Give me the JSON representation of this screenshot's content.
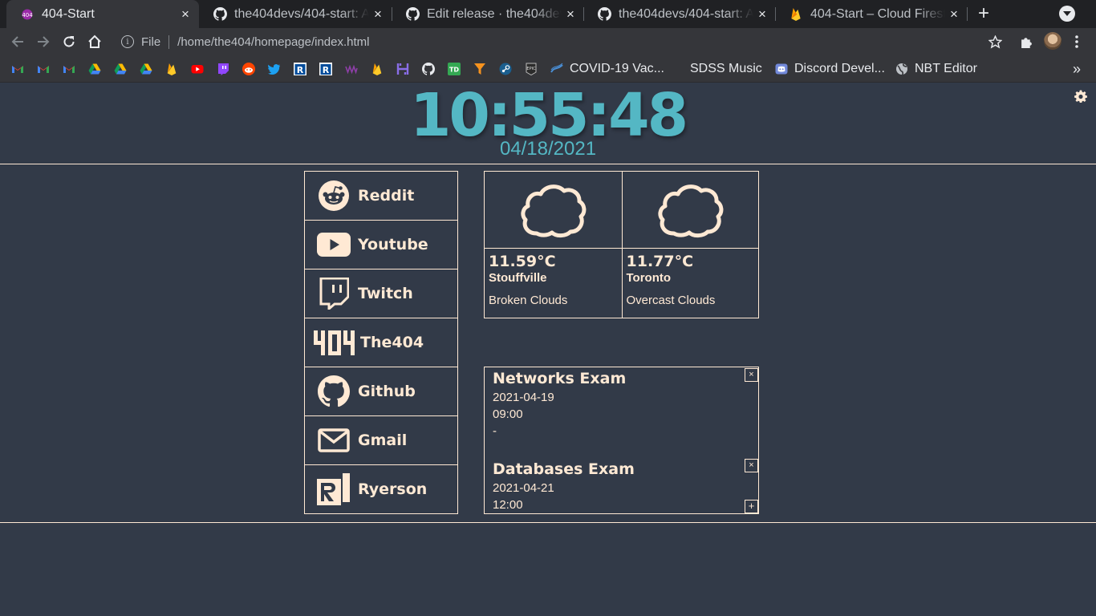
{
  "browser": {
    "tabs": [
      {
        "title": "404-Start",
        "icon": "404-start-favicon",
        "active": true
      },
      {
        "title": "the404devs/404-start: A simple startpage",
        "icon": "github-icon"
      },
      {
        "title": "Edit release · the404devs/404-start",
        "icon": "github-icon"
      },
      {
        "title": "the404devs/404-start: A simple startpage",
        "icon": "github-icon"
      },
      {
        "title": "404-Start – Cloud Firestore",
        "icon": "firebase-icon"
      }
    ],
    "close_glyph": "×",
    "new_tab_glyph": "+",
    "address": {
      "scheme_label": "File",
      "url": "/home/the404/homepage/index.html"
    },
    "bookmarks_named": [
      {
        "label": "COVID-19 Vac...",
        "icon": "covid-icon"
      },
      {
        "label": "SDSS Music",
        "icon": "blank-icon"
      },
      {
        "label": "Discord Devel...",
        "icon": "discord-icon"
      },
      {
        "label": "NBT Editor",
        "icon": "globe-icon"
      }
    ],
    "bookmarks_icons": [
      "gmail-icon",
      "gmail-icon",
      "gmail-icon",
      "drive-icon",
      "drive-icon",
      "drive-icon",
      "firebase-icon",
      "youtube-icon",
      "twitch-icon",
      "reddit-icon",
      "twitter-icon",
      "ryerson-icon",
      "ryerson-icon",
      "wave-icon",
      "firebase-icon",
      "hackernews-icon",
      "github-icon",
      "td-icon",
      "filter-icon",
      "steam-icon",
      "epic-icon"
    ],
    "overflow_glyph": "»"
  },
  "clock": {
    "time": "10:55:48",
    "date": "04/18/2021"
  },
  "links": [
    {
      "label": "Reddit",
      "icon": "reddit-icon"
    },
    {
      "label": "Youtube",
      "icon": "youtube-icon"
    },
    {
      "label": "Twitch",
      "icon": "twitch-icon"
    },
    {
      "label": "The404",
      "icon": "the404-logo-icon"
    },
    {
      "label": "Github",
      "icon": "github-icon"
    },
    {
      "label": "Gmail",
      "icon": "mail-icon"
    },
    {
      "label": "Ryerson",
      "icon": "ryerson-icon"
    }
  ],
  "weather": [
    {
      "temp": "11.59°C",
      "city": "Stouffville",
      "desc": "Broken Clouds",
      "icon": "cloud-icon"
    },
    {
      "temp": "11.77°C",
      "city": "Toronto",
      "desc": "Overcast Clouds",
      "icon": "cloud-icon"
    }
  ],
  "events": [
    {
      "title": "Networks Exam",
      "date": "2021-04-19",
      "time": "09:00",
      "note": "-"
    },
    {
      "title": "Databases Exam",
      "date": "2021-04-21",
      "time": "12:00",
      "note": "-"
    }
  ],
  "event_close_glyph": "×",
  "event_add_glyph": "+",
  "colors": {
    "background": "#323a48",
    "accent": "#54b7c4",
    "foreground": "#ffe9d4"
  }
}
